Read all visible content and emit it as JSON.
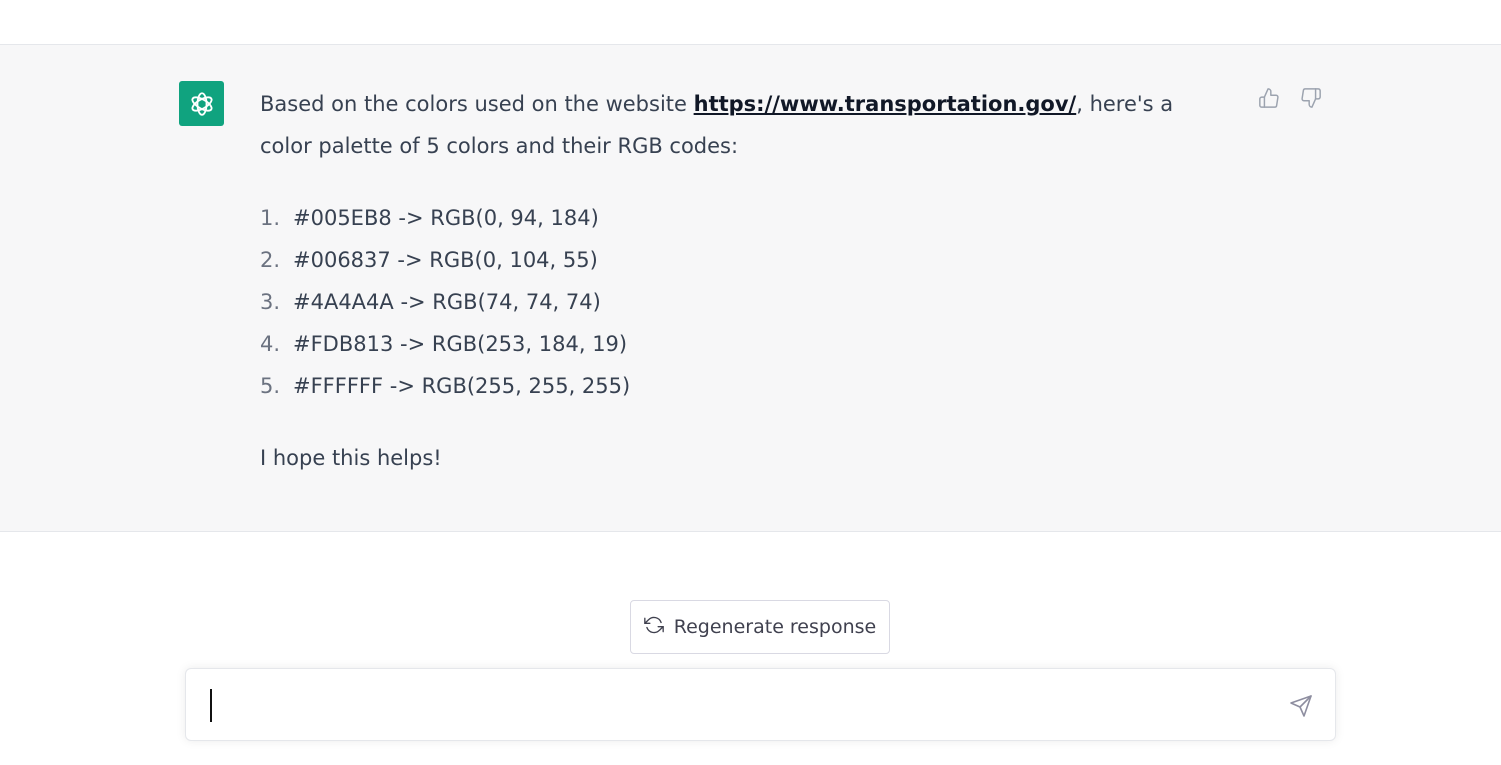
{
  "message": {
    "intro_before_link": "Based on the colors used on the website ",
    "link_text": "https://www.transportation.gov/",
    "intro_after_link": ", here's a color palette of 5 colors and their RGB codes:",
    "palette": [
      {
        "number": "1.",
        "text": "#005EB8 -> RGB(0, 94, 184)"
      },
      {
        "number": "2.",
        "text": "#006837 -> RGB(0, 104, 55)"
      },
      {
        "number": "3.",
        "text": "#4A4A4A -> RGB(74, 74, 74)"
      },
      {
        "number": "4.",
        "text": "#FDB813 -> RGB(253, 184, 19)"
      },
      {
        "number": "5.",
        "text": "#FFFFFF -> RGB(255, 255, 255)"
      }
    ],
    "closing": "I hope this helps!"
  },
  "actions": {
    "regenerate_label": "Regenerate response"
  },
  "input": {
    "value": "",
    "placeholder": ""
  },
  "icons": {
    "avatar": "openai-logo-icon",
    "thumbs_up": "thumbs-up-icon",
    "thumbs_down": "thumbs-down-icon",
    "regenerate": "refresh-icon",
    "send": "send-icon"
  },
  "colors": {
    "avatar_bg": "#10a37f",
    "message_bg": "#f7f7f8",
    "text": "#374151",
    "muted_icon": "#9ca3af"
  }
}
